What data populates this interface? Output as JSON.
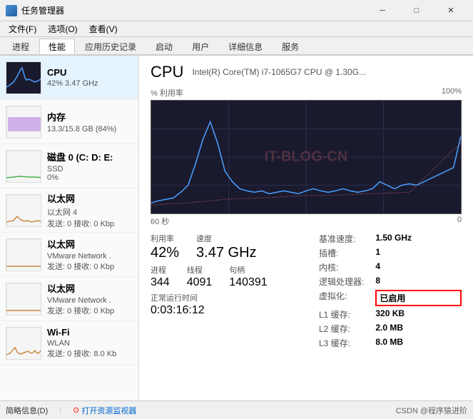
{
  "titlebar": {
    "title": "任务管理器",
    "minimize": "─",
    "maximize": "□",
    "close": "✕"
  },
  "menubar": {
    "items": [
      "文件(F)",
      "选项(O)",
      "查看(V)"
    ]
  },
  "tabs": [
    {
      "label": "进程",
      "active": false
    },
    {
      "label": "性能",
      "active": true
    },
    {
      "label": "应用历史记录",
      "active": false
    },
    {
      "label": "启动",
      "active": false
    },
    {
      "label": "用户",
      "active": false
    },
    {
      "label": "详细信息",
      "active": false
    },
    {
      "label": "服务",
      "active": false
    }
  ],
  "sidebar": {
    "items": [
      {
        "name": "CPU",
        "sub1": "42% 3.47 GHz",
        "sub2": "",
        "active": true,
        "color": "#4a9eff"
      },
      {
        "name": "内存",
        "sub1": "13.3/15.8 GB (84%)",
        "sub2": "",
        "active": false,
        "color": "#9966cc"
      },
      {
        "name": "磁盘 0 (C: D: E:",
        "sub1": "SSD",
        "sub2": "0%",
        "active": false,
        "color": "#4db34d"
      },
      {
        "name": "以太网",
        "sub1": "以太网 4",
        "sub2": "发送: 0  接收: 0 Kbp",
        "active": false,
        "color": "#cc8844"
      },
      {
        "name": "以太网",
        "sub1": "VMware Network .",
        "sub2": "发送: 0  接收: 0 Kbp",
        "active": false,
        "color": "#cc8844"
      },
      {
        "name": "以太网",
        "sub1": "VMware Network .",
        "sub2": "发送: 0  接收: 0 Kbp",
        "active": false,
        "color": "#cc8844"
      },
      {
        "name": "Wi-Fi",
        "sub1": "WLAN",
        "sub2": "发送: 0  接收: 8.0 Kb",
        "active": false,
        "color": "#cc8844"
      }
    ]
  },
  "cpu_panel": {
    "title": "CPU",
    "subtitle": "Intel(R) Core(TM) i7-1065G7 CPU @ 1.30G...",
    "graph_label_left": "% 利用率",
    "graph_label_right": "100%",
    "time_label_left": "60 秒",
    "time_label_right": "0",
    "watermark": "IT-BLOG-CN",
    "stats": {
      "utilization_label": "利用率",
      "utilization_value": "42%",
      "speed_label": "速度",
      "speed_value": "3.47 GHz",
      "processes_label": "进程",
      "processes_value": "344",
      "threads_label": "线程",
      "threads_value": "4091",
      "handles_label": "句柄",
      "handles_value": "140391",
      "uptime_label": "正常运行时间",
      "uptime_value": "0:03:16:12"
    },
    "info": {
      "base_speed_label": "基准速度:",
      "base_speed_value": "1.50 GHz",
      "sockets_label": "插槽:",
      "sockets_value": "1",
      "cores_label": "内核:",
      "cores_value": "4",
      "logical_label": "逻辑处理器:",
      "logical_value": "8",
      "virtualization_label": "虚拟化:",
      "virtualization_value": "已启用",
      "l1_cache_label": "L1 缓存:",
      "l1_cache_value": "320 KB",
      "l2_cache_label": "L2 缓存:",
      "l2_cache_value": "2.0 MB",
      "l3_cache_label": "L3 缓存:",
      "l3_cache_value": "8.0 MB"
    }
  },
  "statusbar": {
    "summary": "简略信息(D)",
    "open_monitor": "打开资源监视器",
    "copyright": "CSDN @程序猿进阶"
  }
}
